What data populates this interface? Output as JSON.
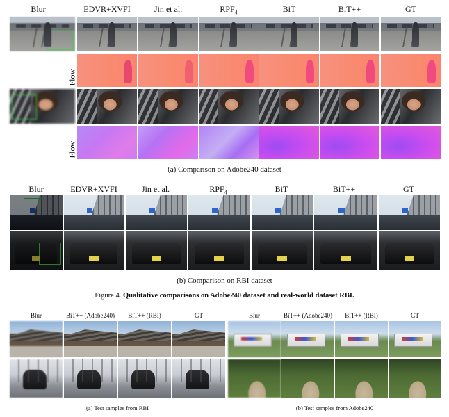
{
  "top_section": {
    "columns": [
      "Blur",
      "EDVR+XVFI",
      "Jin et al.",
      "RPF",
      "BiT",
      "BiT++",
      "GT"
    ],
    "rpf_subscript": "4",
    "row_label": "Flow",
    "caption": "(a) Comparison on Adobe240 dataset"
  },
  "mid_section": {
    "columns": [
      "Blur",
      "EDVR+XVFI",
      "Jin et al.",
      "RPF",
      "BiT",
      "BiT++",
      "GT"
    ],
    "rpf_subscript": "4",
    "caption": "(b) Comparison on RBI dataset"
  },
  "figure4": {
    "prefix": "Figure 4. ",
    "bold_text": "Qualitative comparisons on Adobe240 dataset and real-world dataset RBI."
  },
  "bottom_left": {
    "columns": [
      "Blur",
      "BiT++ (Adobe240)",
      "BiT++ (RBI)",
      "GT"
    ],
    "caption": "(a) Test samples from RBI"
  },
  "bottom_right": {
    "columns": [
      "Blur",
      "BiT++ (Adobe240)",
      "BiT++ (RBI)",
      "GT"
    ],
    "caption": "(b) Test samples from Adobe240"
  }
}
